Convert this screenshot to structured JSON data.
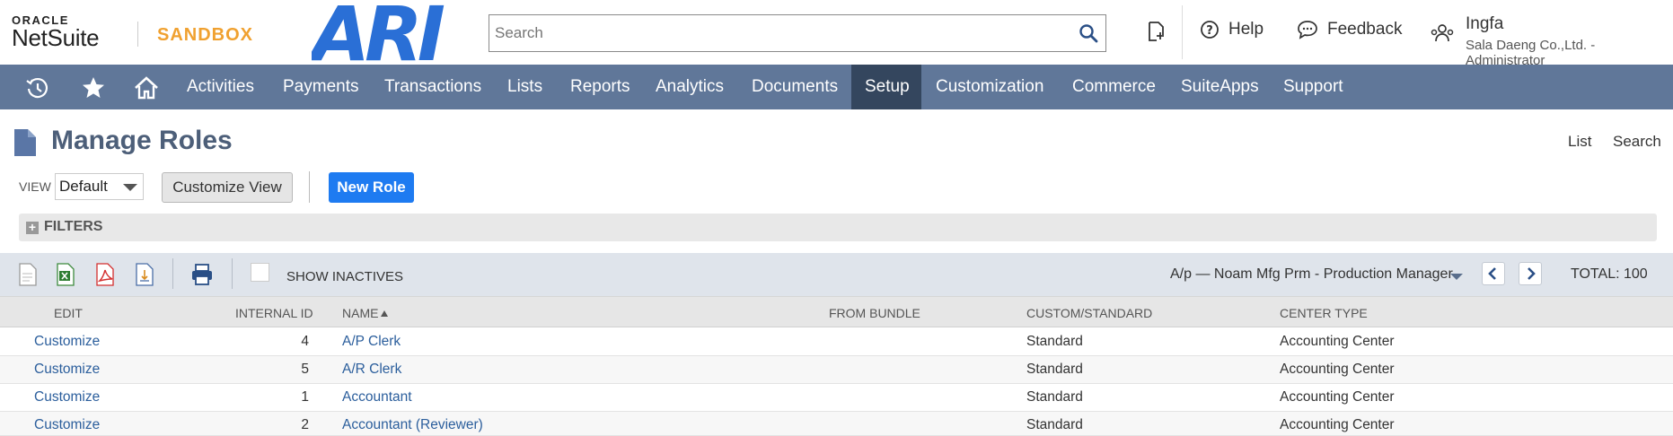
{
  "header": {
    "oracle_label": "ORACLE",
    "netsuite_label": "NetSuite",
    "environment_label": "SANDBOX",
    "company_logo_text": "ARI",
    "search_placeholder": "Search",
    "help_label": "Help",
    "feedback_label": "Feedback",
    "user_name": "Ingfa",
    "user_subtitle": "Sala Daeng Co.,Ltd. - Administrator"
  },
  "nav": {
    "items": [
      {
        "label": "Activities"
      },
      {
        "label": "Payments"
      },
      {
        "label": "Transactions"
      },
      {
        "label": "Lists"
      },
      {
        "label": "Reports"
      },
      {
        "label": "Analytics"
      },
      {
        "label": "Documents"
      },
      {
        "label": "Setup",
        "active": true
      },
      {
        "label": "Customization"
      },
      {
        "label": "Commerce"
      },
      {
        "label": "SuiteApps"
      },
      {
        "label": "Support"
      }
    ]
  },
  "page": {
    "title": "Manage Roles",
    "list_link": "List",
    "search_link": "Search",
    "view_label": "VIEW",
    "view_value": "Default",
    "customize_view_label": "Customize View",
    "new_role_label": "New Role",
    "filters_label": "FILTERS"
  },
  "toolbar": {
    "show_inactives_label": "SHOW INACTIVES",
    "selected_view": "A/p — Noam Mfg Prm - Production Manager",
    "total_label": "TOTAL: 100"
  },
  "table": {
    "headers": {
      "edit": "EDIT",
      "internal_id": "INTERNAL ID",
      "name": "NAME",
      "from_bundle": "FROM BUNDLE",
      "custom_standard": "CUSTOM/STANDARD",
      "center_type": "CENTER TYPE"
    },
    "rows": [
      {
        "edit": "Customize",
        "id": "4",
        "name": "A/P Clerk",
        "bundle": "",
        "type": "Standard",
        "center": "Accounting Center"
      },
      {
        "edit": "Customize",
        "id": "5",
        "name": "A/R Clerk",
        "bundle": "",
        "type": "Standard",
        "center": "Accounting Center"
      },
      {
        "edit": "Customize",
        "id": "1",
        "name": "Accountant",
        "bundle": "",
        "type": "Standard",
        "center": "Accounting Center"
      },
      {
        "edit": "Customize",
        "id": "2",
        "name": "Accountant (Reviewer)",
        "bundle": "",
        "type": "Standard",
        "center": "Accounting Center"
      }
    ]
  },
  "colors": {
    "nav_bg": "#607799",
    "nav_active": "#34465e",
    "primary_button": "#1e7bf1",
    "sandbox_orange": "#f0a130",
    "logo_blue": "#2a6fd6",
    "link": "#2b5e9c",
    "title": "#4d5f79"
  }
}
